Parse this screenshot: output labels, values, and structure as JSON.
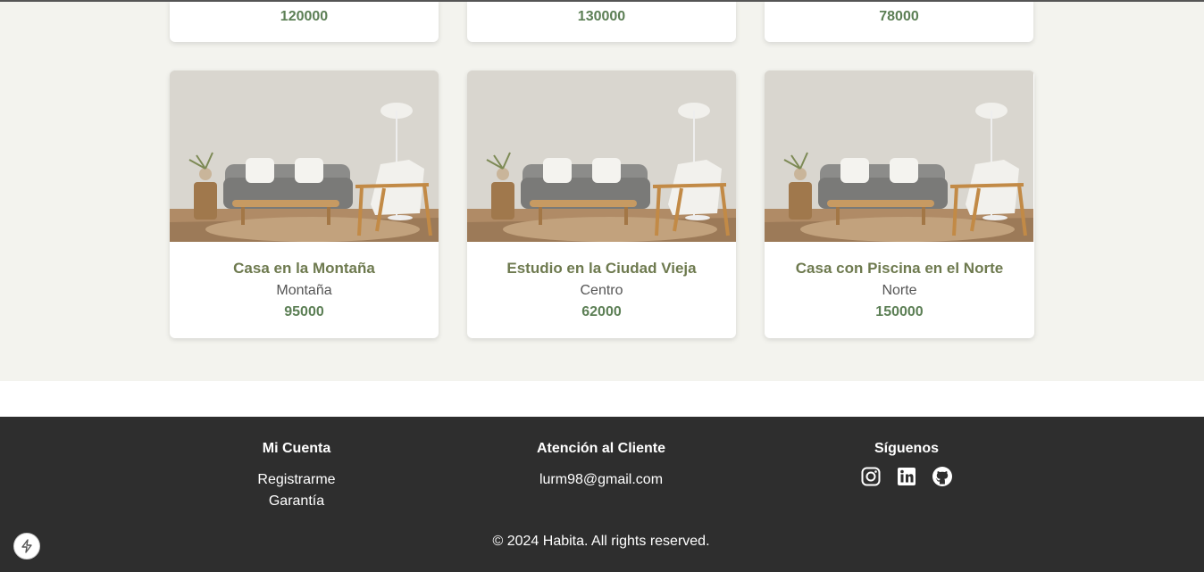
{
  "listings_top": [
    {
      "price": "120000"
    },
    {
      "price": "130000"
    },
    {
      "price": "78000"
    }
  ],
  "listings": [
    {
      "title": "Casa en la Montaña",
      "location": "Montaña",
      "price": "95000"
    },
    {
      "title": "Estudio en la Ciudad Vieja",
      "location": "Centro",
      "price": "62000"
    },
    {
      "title": "Casa con Piscina en el Norte",
      "location": "Norte",
      "price": "150000"
    }
  ],
  "footer": {
    "account": {
      "heading": "Mi Cuenta",
      "links": [
        "Registrarme",
        "Garantía"
      ]
    },
    "support": {
      "heading": "Atención al Cliente",
      "email": "lurm98@gmail.com"
    },
    "social": {
      "heading": "Síguenos",
      "icons": [
        "instagram-icon",
        "linkedin-icon",
        "github-icon"
      ]
    },
    "copyright": "© 2024 Habita. All rights reserved."
  },
  "colors": {
    "accent_green": "#5c7f55",
    "title_olive": "#6e7a4f",
    "section_bg": "#f3f3ee",
    "footer_bg": "#2e2e2e"
  }
}
